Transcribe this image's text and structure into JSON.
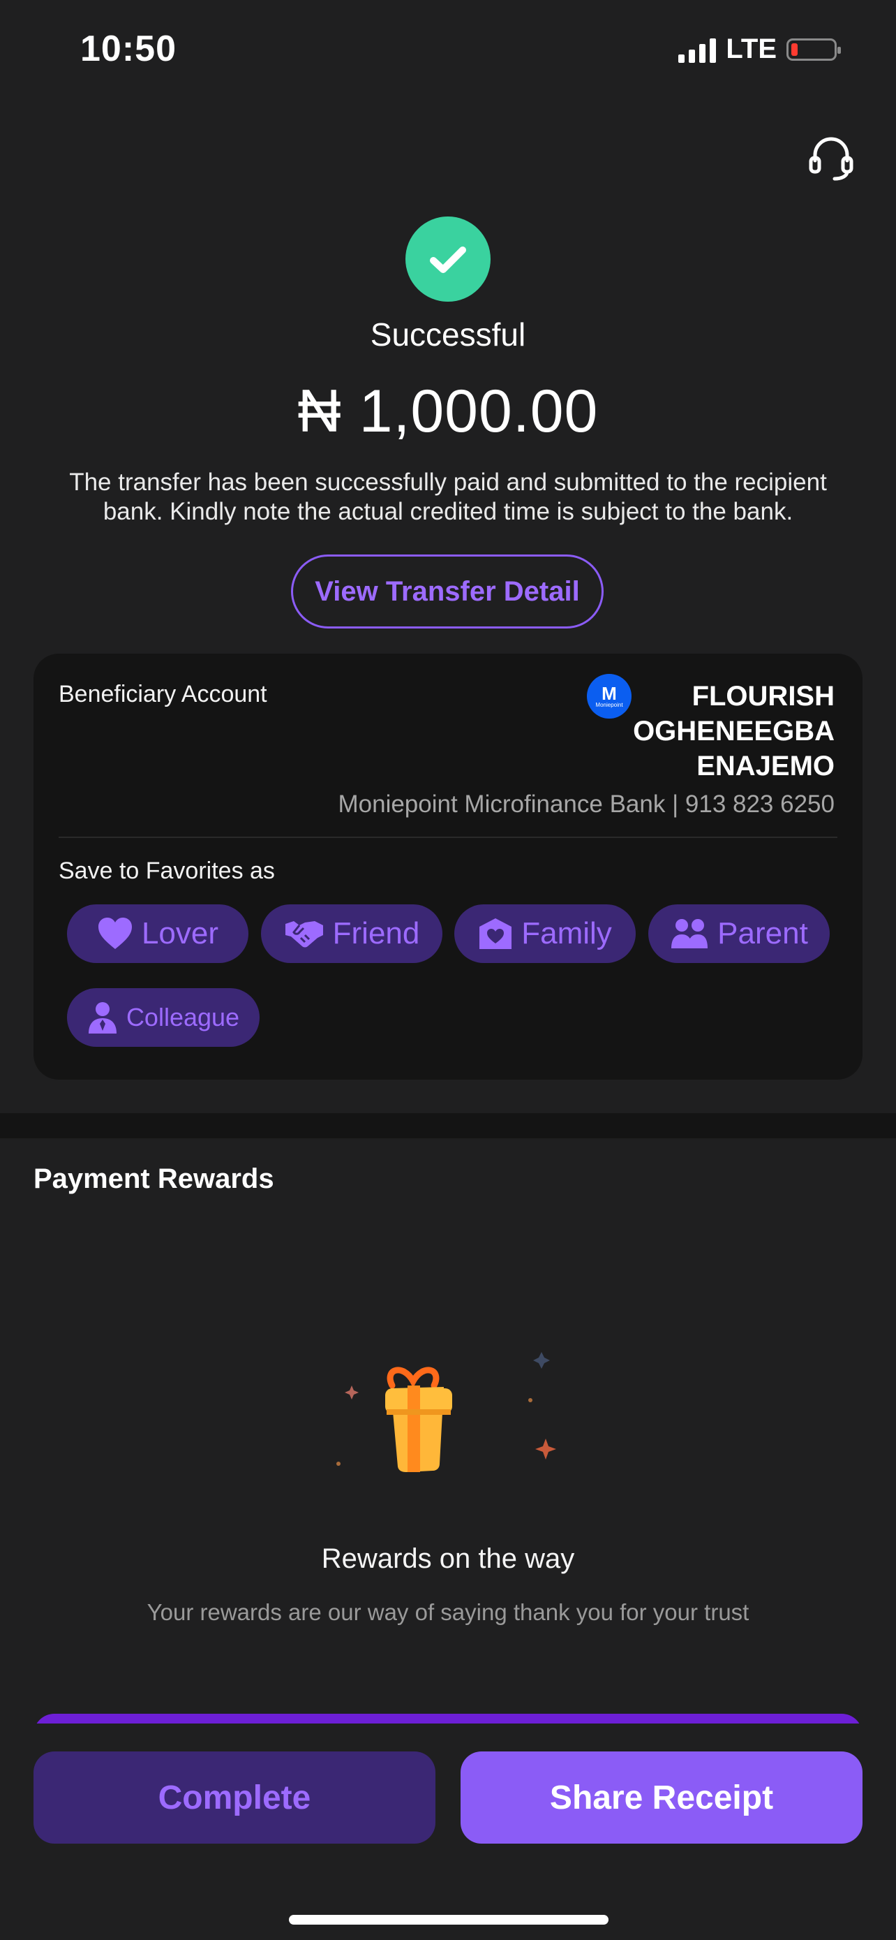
{
  "status_bar": {
    "time": "10:50",
    "network": "LTE",
    "battery_level": 0.15
  },
  "header": {
    "support_icon": "headset-icon"
  },
  "result": {
    "icon": "check-icon",
    "title": "Successful",
    "amount": "₦ 1,000.00",
    "message": "The transfer has been successfully paid and submitted to the recipient bank. Kindly note the actual credited time is subject to the bank.",
    "view_detail_label": "View Transfer Detail"
  },
  "beneficiary": {
    "label": "Beneficiary Account",
    "bank_logo_letter": "M",
    "bank_logo_text": "Moniepoint",
    "name_lines": [
      "FLOURISH",
      "OGHENEEGBA",
      "ENAJEMO"
    ],
    "bank_and_account": "Moniepoint Microfinance Bank | 913 823 6250"
  },
  "favorites": {
    "label": "Save to Favorites as",
    "options": [
      {
        "label": "Lover",
        "icon": "heart-icon"
      },
      {
        "label": "Friend",
        "icon": "handshake-icon"
      },
      {
        "label": "Family",
        "icon": "house-heart-icon"
      },
      {
        "label": "Parent",
        "icon": "people-icon"
      },
      {
        "label": "Colleague",
        "icon": "person-tie-icon"
      }
    ]
  },
  "rewards": {
    "title": "Payment Rewards",
    "icon": "gift-icon",
    "heading": "Rewards on the way",
    "subtitle": "Your rewards are our way of saying thank you for your trust"
  },
  "actions": {
    "complete_label": "Complete",
    "share_label": "Share Receipt"
  },
  "colors": {
    "accent": "#8b5cf6",
    "accent_text": "#9d6bff",
    "success": "#3ad29f",
    "chip_bg": "#3b2774",
    "background": "#1f1f20"
  }
}
